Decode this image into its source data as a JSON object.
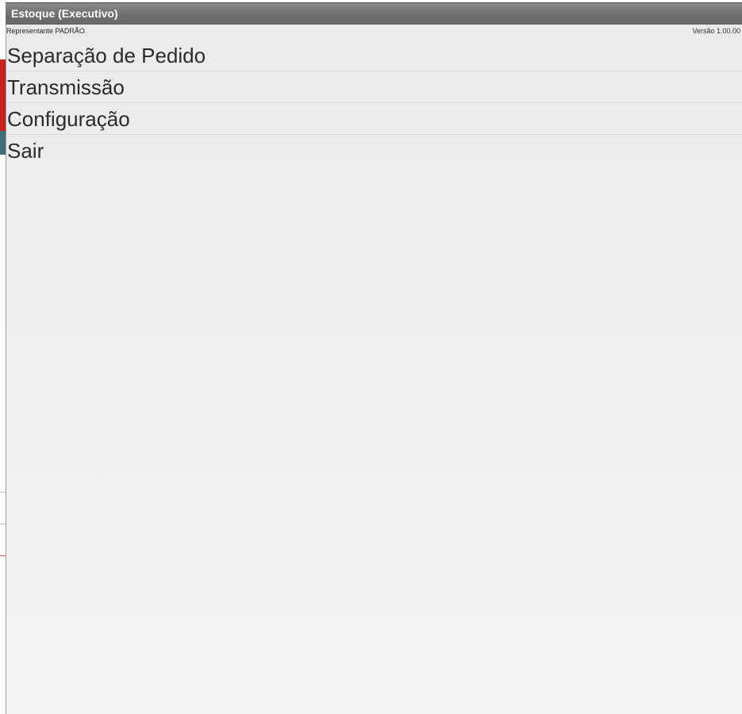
{
  "dialog": {
    "title": "Estoque (Executivo)",
    "representative": "Representante PADRÃO",
    "version": "Versão 1.00.00"
  },
  "menu": {
    "items": [
      {
        "label": "Separação de Pedido"
      },
      {
        "label": "Transmissão"
      },
      {
        "label": "Configuração"
      },
      {
        "label": "Sair"
      }
    ]
  },
  "colors": {
    "titlebar": "#767676",
    "dialog_background": "#eeeeee",
    "menu_text": "#2b2b2b",
    "background_app_accent_red": "#c8201e",
    "background_app_accent_teal": "#3f6d78"
  }
}
